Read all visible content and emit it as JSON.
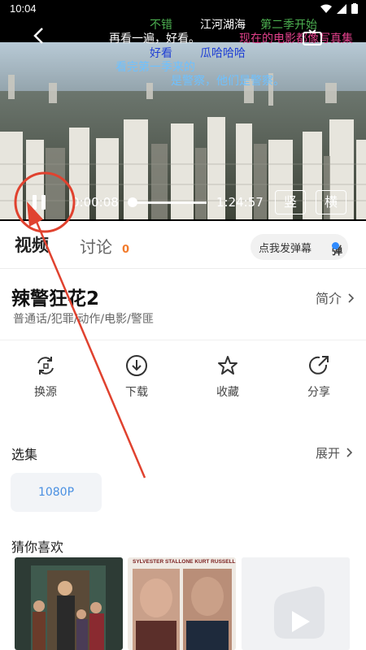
{
  "status_bar": {
    "time": "10:04"
  },
  "player": {
    "danmaku": [
      {
        "text": "不错",
        "color": "#4caf50"
      },
      {
        "text": "江河湖海",
        "color": "#ffffff"
      },
      {
        "text": "第二季开始",
        "color": "#4caf50"
      },
      {
        "text": "再看一遍，好看。",
        "color": "#ffffff"
      },
      {
        "text": "现在的电影都像写真集",
        "color": "#e0408a"
      },
      {
        "text": "好看",
        "color": "#1f3fd4"
      },
      {
        "text": "瓜哈哈哈",
        "color": "#1f3fd4"
      },
      {
        "text": "看完第一季来的",
        "color": "#6ec1ff"
      },
      {
        "text": "是警察，他们是警察。",
        "color": "#6ec1ff"
      }
    ],
    "current_time": "0:00:08",
    "duration": "1:24:57",
    "progress_fraction": 0.001,
    "portrait_label": "竖",
    "landscape_label": "横"
  },
  "tabs": {
    "video": "视频",
    "discussion": "讨论",
    "discussion_count": "0",
    "danmaku_button": "点我发弹幕",
    "danmaku_icon_char": "弹"
  },
  "info": {
    "title": "辣警狂花2",
    "tags": "普通话/犯罪/动作/电影/警匪",
    "intro_label": "简介"
  },
  "actions": [
    {
      "label": "换源",
      "icon": "switch-source-icon"
    },
    {
      "label": "下载",
      "icon": "download-icon"
    },
    {
      "label": "收藏",
      "icon": "star-icon"
    },
    {
      "label": "分享",
      "icon": "share-icon"
    }
  ],
  "episodes": {
    "heading": "选集",
    "expand_label": "展开",
    "items": [
      "1080P"
    ]
  },
  "recommend": {
    "heading": "猜你喜欢",
    "posters": [
      {
        "credit": ""
      },
      {
        "credit": "SYLVESTER STALLONE   KURT RUSSELL"
      },
      {
        "credit": ""
      }
    ]
  }
}
